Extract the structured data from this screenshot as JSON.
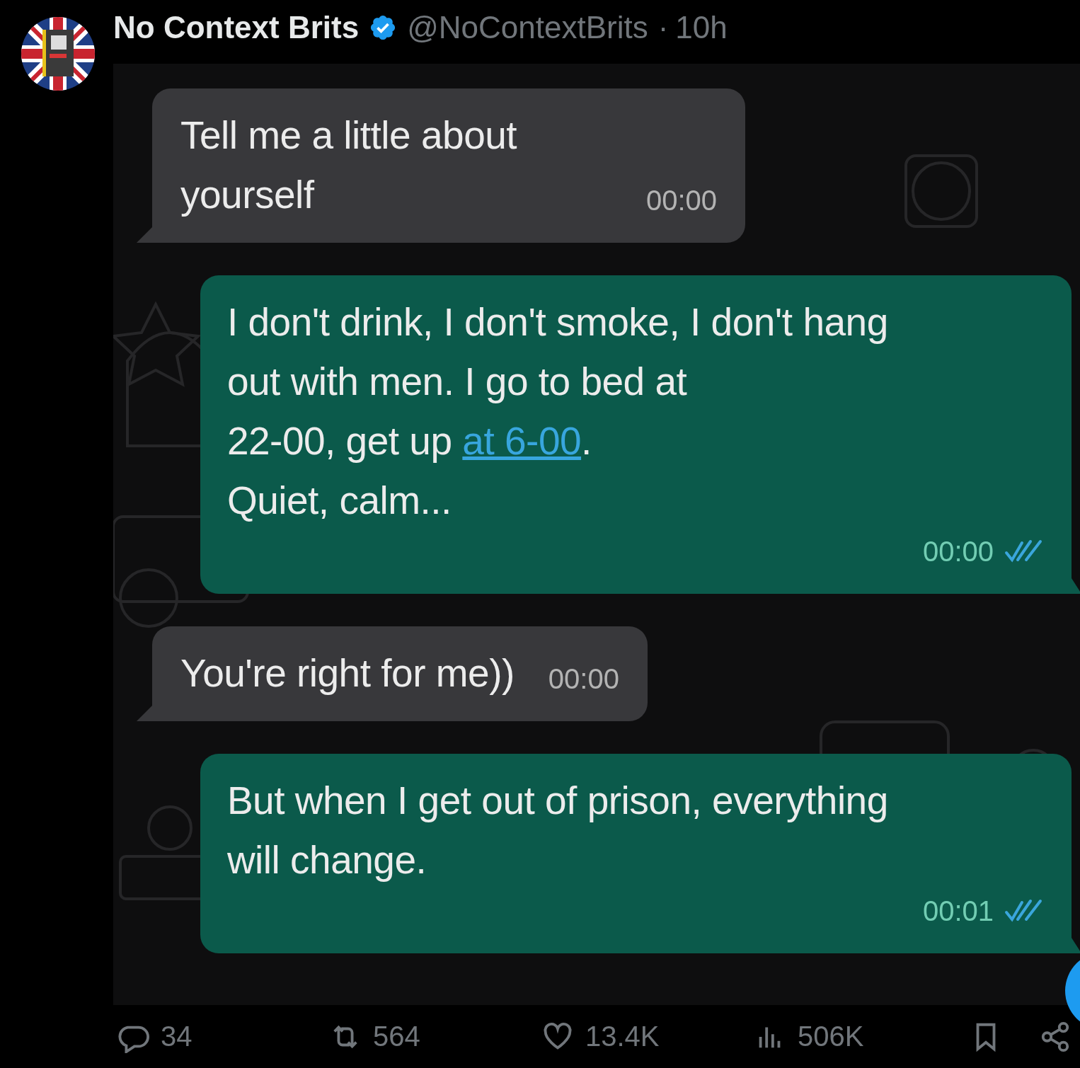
{
  "post": {
    "author": "No Context Brits",
    "verified": true,
    "handle": "@NoContextBrits",
    "separator": "·",
    "age": "10h"
  },
  "chat": {
    "messages": [
      {
        "kind": "incoming",
        "parts": [
          {
            "kind": "plain",
            "text": "Tell me a little about yourself"
          }
        ],
        "time": "00:00"
      },
      {
        "kind": "outgoing",
        "parts": [
          {
            "kind": "plain",
            "text": "I don't drink, I don't smoke, I don't hang out with men. I go to bed at\n22-00, get up "
          },
          {
            "kind": "link",
            "text": "at 6-00"
          },
          {
            "kind": "plain",
            "text": ".\nQuiet, calm..."
          }
        ],
        "time": "00:00",
        "read": true
      },
      {
        "kind": "incoming",
        "parts": [
          {
            "kind": "plain",
            "text": "You're right for me))"
          }
        ],
        "time": "00:00"
      },
      {
        "kind": "outgoing",
        "parts": [
          {
            "kind": "plain",
            "text": "But when I get out of prison, everything will change."
          }
        ],
        "time": "00:01",
        "read": true
      }
    ]
  },
  "actions": [
    {
      "kind": "reply",
      "count": "34"
    },
    {
      "kind": "repost",
      "count": "564"
    },
    {
      "kind": "like",
      "count": "13.4K"
    },
    {
      "kind": "views",
      "count": "506K"
    },
    {
      "kind": "bookmark"
    },
    {
      "kind": "share"
    }
  ]
}
